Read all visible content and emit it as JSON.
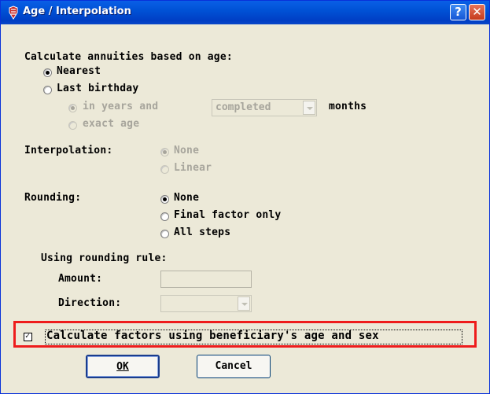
{
  "window": {
    "title": "Age / Interpolation",
    "help_glyph": "?",
    "close_glyph": "✕"
  },
  "annuities": {
    "heading": "Calculate annuities based on age:",
    "nearest": "Nearest",
    "last_birthday": "Last birthday",
    "in_years_and": "in years and",
    "completed_value": "completed",
    "months": "months",
    "exact_age": "exact age"
  },
  "interpolation": {
    "label": "Interpolation:",
    "none": "None",
    "linear": "Linear"
  },
  "rounding": {
    "label": "Rounding:",
    "none": "None",
    "final_factor_only": "Final factor only",
    "all_steps": "All steps"
  },
  "rounding_rule": {
    "heading": "Using rounding rule:",
    "amount_label": "Amount:",
    "amount_value": "",
    "direction_label": "Direction:",
    "direction_value": ""
  },
  "beneficiary": {
    "label": "Calculate factors using beneficiary's age and sex",
    "checked": true
  },
  "buttons": {
    "ok": "OK",
    "cancel": "Cancel"
  },
  "colors": {
    "titlebar": "#0055e5",
    "highlight": "#ee1c1c",
    "dialog_bg": "#ece9d8"
  }
}
